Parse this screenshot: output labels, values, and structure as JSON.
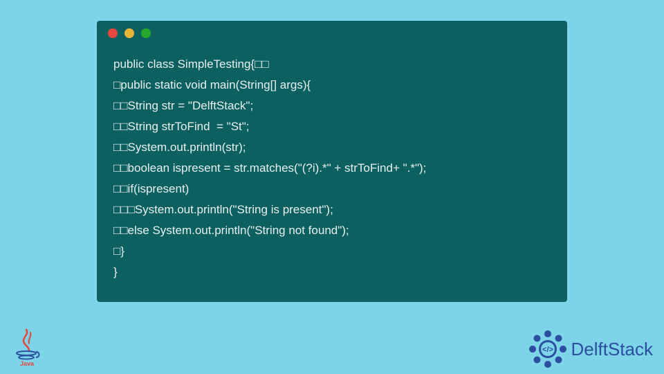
{
  "code_lines": [
    "public class SimpleTesting{□□",
    "□public static void main(String[] args){",
    "□□String str = \"DelftStack\";",
    "□□String strToFind  = \"St\";",
    "□□System.out.println(str);",
    "□□boolean ispresent = str.matches(\"(?i).*\" + strToFind+ \".*\");",
    "□□if(ispresent)",
    "□□□System.out.println(\"String is present\");",
    "□□else System.out.println(\"String not found\");",
    "□}",
    "}"
  ],
  "java_label": "Java",
  "brand": {
    "name": "DelftStack"
  },
  "colors": {
    "bg": "#7dd3e8",
    "window": "#0d6060",
    "code_text": "#e8f0ef",
    "brand_text": "#2a4f9e",
    "dot_red": "#e7473c",
    "dot_yellow": "#e8b339",
    "dot_green": "#29a82e"
  }
}
